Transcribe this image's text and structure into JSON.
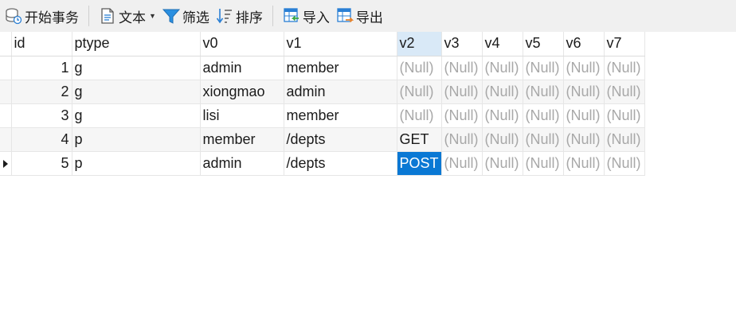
{
  "toolbar": {
    "begin_transaction": "开始事务",
    "text": "文本",
    "filter": "筛选",
    "sort": "排序",
    "import": "导入",
    "export": "导出"
  },
  "table": {
    "columns": [
      "id",
      "ptype",
      "v0",
      "v1",
      "v2",
      "v3",
      "v4",
      "v5",
      "v6",
      "v7"
    ],
    "selected_column": "v2",
    "rows": [
      [
        "1",
        "g",
        "admin",
        "member",
        "(Null)",
        "(Null)",
        "(Null)",
        "(Null)",
        "(Null)",
        "(Null)"
      ],
      [
        "2",
        "g",
        "xiongmao",
        "admin",
        "(Null)",
        "(Null)",
        "(Null)",
        "(Null)",
        "(Null)",
        "(Null)"
      ],
      [
        "3",
        "g",
        "lisi",
        "member",
        "(Null)",
        "(Null)",
        "(Null)",
        "(Null)",
        "(Null)",
        "(Null)"
      ],
      [
        "4",
        "p",
        "member",
        "/depts",
        "GET",
        "(Null)",
        "(Null)",
        "(Null)",
        "(Null)",
        "(Null)"
      ],
      [
        "5",
        "p",
        "admin",
        "/depts",
        "POST",
        "(Null)",
        "(Null)",
        "(Null)",
        "(Null)",
        "(Null)"
      ]
    ],
    "current_row": 5,
    "selected_cell": {
      "row": 5,
      "column": "v2"
    }
  },
  "colors": {
    "selection": "#0a78d4",
    "column_header_highlight": "#d9e9f7",
    "null_text": "#a8a8a8",
    "toolbar_bg": "#f0f0f0"
  }
}
